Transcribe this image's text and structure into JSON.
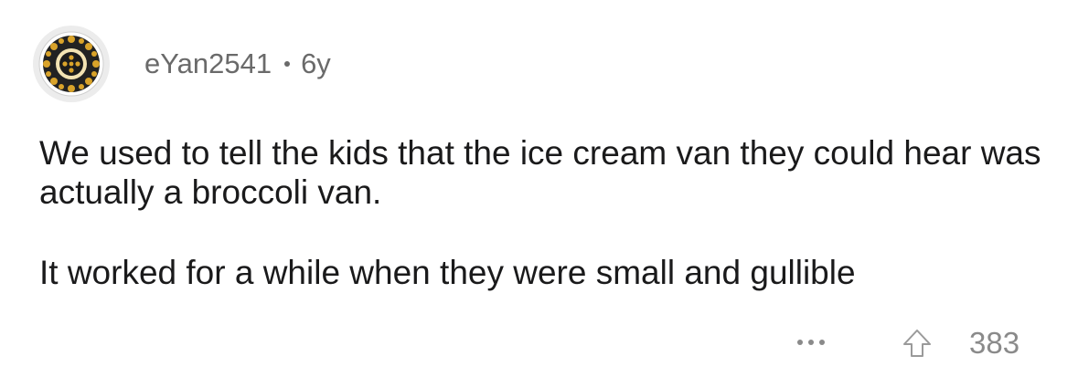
{
  "comment": {
    "author": "eYan2541",
    "age": "6y",
    "paragraphs": [
      "We used to tell the kids that the ice cream van they could hear was actually a broccoli van.",
      "It worked for a while when they were small and gullible"
    ],
    "score": "383"
  },
  "icons": {
    "avatar": "avatar-mandala-icon",
    "more": "more-options-icon",
    "upvote": "upvote-arrow-icon"
  },
  "colors": {
    "text": "#1a1a1b",
    "meta": "#6a6a6a",
    "muted": "#8a8a8a",
    "avatar_bg": "#ececec",
    "avatar_gold": "#d9a32a"
  }
}
